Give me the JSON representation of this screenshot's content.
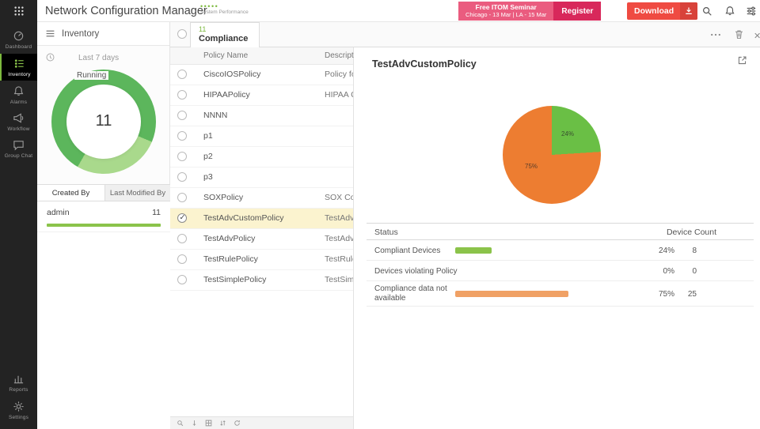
{
  "app": {
    "title": "Network Configuration Manager",
    "system_performance": "System Performance",
    "banner": {
      "line1": "Free ITOM Seminar",
      "line2": "Chicago - 13 Mar | LA - 15 Mar",
      "register": "Register"
    },
    "download_label": "Download"
  },
  "colors": {
    "accent_green": "#7cb93e",
    "bar_green": "#8bc34a",
    "orange": "#ed7d31",
    "banner_pink": "#ea5c7f",
    "download_red": "#ef4b42",
    "selected_row_yellow": "#fbf3cf"
  },
  "sidebar": {
    "items": [
      {
        "label": "Dashboard"
      },
      {
        "label": "Inventory",
        "active": true
      },
      {
        "label": "Alarms"
      },
      {
        "label": "Workflow"
      },
      {
        "label": "Group Chat"
      },
      {
        "label": "Reports"
      },
      {
        "label": "Settings"
      }
    ]
  },
  "inventory_panel": {
    "title": "Inventory",
    "range": "Last 7 days",
    "tabs": [
      {
        "label": "Created By",
        "active": true
      },
      {
        "label": "Last Modified By"
      }
    ],
    "rows": [
      {
        "name": "admin",
        "count": "11"
      }
    ]
  },
  "policies_panel": {
    "tab": {
      "count": "11",
      "label": "Compliance"
    },
    "columns": [
      "Policy Name",
      "Description"
    ],
    "rows": [
      {
        "name": "CiscoIOSPolicy",
        "description": "Policy for C"
      },
      {
        "name": "HIPAAPolicy",
        "description": "HIPAA Con"
      },
      {
        "name": "NNNN",
        "description": ""
      },
      {
        "name": "p1",
        "description": ""
      },
      {
        "name": "p2",
        "description": ""
      },
      {
        "name": "p3",
        "description": ""
      },
      {
        "name": "SOXPolicy",
        "description": "SOX Comp"
      },
      {
        "name": "TestAdvCustomPolicy",
        "description": "TestAdvCu",
        "selected": true
      },
      {
        "name": "TestAdvPolicy",
        "description": "TestAdvPo"
      },
      {
        "name": "TestRulePolicy",
        "description": "TestRulePo"
      },
      {
        "name": "TestSimplePolicy",
        "description": "TestSimple"
      }
    ]
  },
  "detail_panel": {
    "title": "TestAdvCustomPolicy",
    "table": {
      "columns": [
        "Status",
        "Device Count"
      ],
      "rows": [
        {
          "status": "Compliant Devices",
          "percent": "24%",
          "count": "8",
          "bar_pct": 24,
          "bar_color": "#8bc34a"
        },
        {
          "status": "Devices violating Policy",
          "percent": "0%",
          "count": "0",
          "bar_pct": 0,
          "bar_color": "transparent"
        },
        {
          "status": "Compliance data not available",
          "percent": "75%",
          "count": "25",
          "bar_pct": 75,
          "bar_color": "#f0a165"
        }
      ]
    }
  },
  "chart_data": [
    {
      "type": "donut",
      "title": "Running",
      "center_value": 11,
      "series": [
        {
          "name": "Running",
          "value": 11
        }
      ],
      "segments": [
        {
          "color": "#5cb65c",
          "pct": 73
        },
        {
          "color": "#a9d98c",
          "pct": 27
        }
      ],
      "start_deg": 210,
      "legend": "Created By: admin = 11"
    },
    {
      "type": "pie",
      "title": "TestAdvCustomPolicy",
      "slices": [
        {
          "label": "Compliant Devices",
          "pct": 24,
          "color": "#6abf45",
          "display_label": "24%"
        },
        {
          "label": "Devices violating Policy",
          "pct": 0,
          "color": "#e57373",
          "display_label": ""
        },
        {
          "label": "Compliance data not available",
          "pct": 75,
          "color": "#ed7d31",
          "display_label": "75%"
        }
      ]
    }
  ]
}
